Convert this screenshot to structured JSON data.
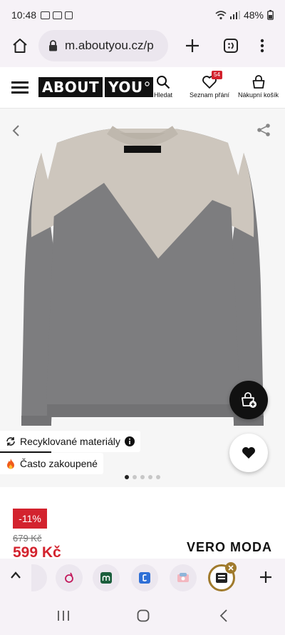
{
  "status_bar": {
    "time": "10:48",
    "battery": "48%"
  },
  "browser": {
    "url": "m.aboutyou.cz/p"
  },
  "header": {
    "logo_left": "ABOUT",
    "logo_right": "YOU",
    "search_label": "Hledat",
    "wishlist_label": "Seznam přání",
    "wishlist_count": "54",
    "cart_label": "Nákupní košík"
  },
  "gallery": {
    "chip_recycled": "Recyklované materiály",
    "chip_popular": "Často zakoupené",
    "slide_count": 5,
    "active_slide": 1
  },
  "product": {
    "discount": "-11%",
    "old_price": "679 Kč",
    "price": "599 Kč",
    "brand": "VERO MODA"
  },
  "colors": {
    "accent": "#d3232e",
    "sweater_light": "#cdc6bd",
    "sweater_dark": "#7d7d7f"
  }
}
